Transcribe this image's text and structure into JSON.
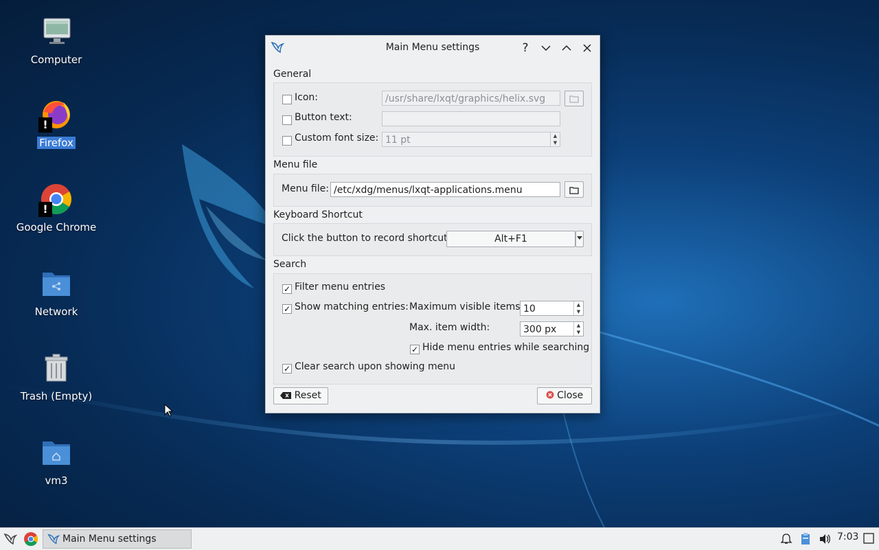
{
  "desktop": {
    "icons": [
      {
        "label": "Computer"
      },
      {
        "label": "Firefox"
      },
      {
        "label": "Google Chrome"
      },
      {
        "label": "Network"
      },
      {
        "label": "Trash (Empty)"
      },
      {
        "label": "vm3"
      }
    ]
  },
  "dialog": {
    "title": "Main Menu settings",
    "help": "?",
    "minimize": "⌄",
    "maximize": "⌃",
    "close": "✕",
    "general": {
      "title": "General",
      "icon_label": "Icon:",
      "icon_value": "/usr/share/lxqt/graphics/helix.svg",
      "button_text_label": "Button text:",
      "button_text_value": "",
      "font_size_label": "Custom font size:",
      "font_size_value": "11 pt",
      "icon_checked": false,
      "button_text_checked": false,
      "font_size_checked": false
    },
    "menu_file": {
      "title": "Menu file",
      "label": "Menu file:",
      "value": "/etc/xdg/menus/lxqt-applications.menu"
    },
    "shortcut": {
      "title": "Keyboard Shortcut",
      "label": "Click the button to record shortcut:",
      "value": "Alt+F1"
    },
    "search": {
      "title": "Search",
      "filter_label": "Filter menu entries",
      "show_matching_label": "Show matching entries:",
      "max_visible_label": "Maximum visible items:",
      "max_visible_value": "10",
      "max_width_label": "Max. item width:",
      "max_width_value": "300 px",
      "hide_entries_label": "Hide menu entries while searching",
      "clear_search_label": "Clear search upon showing menu",
      "check_mark": "✓"
    },
    "reset_label": "Reset",
    "close_label": "Close"
  },
  "taskbar": {
    "task_title": "Main Menu settings",
    "clock": "7:03"
  },
  "colors": {
    "selection": "#3a7bd5",
    "close_red": "#d9534f"
  }
}
